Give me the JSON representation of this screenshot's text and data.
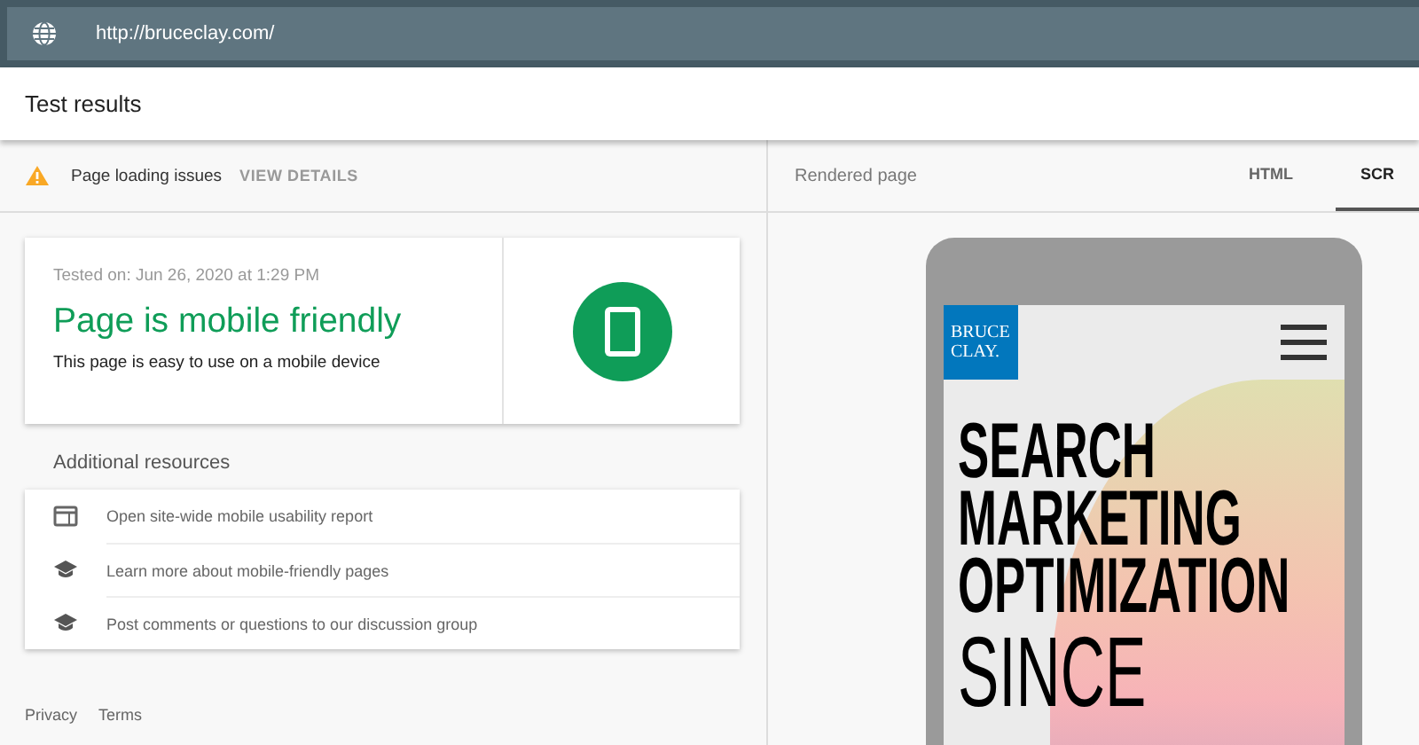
{
  "url_bar": {
    "url": "http://bruceclay.com/"
  },
  "header": {
    "title": "Test results"
  },
  "issues": {
    "label": "Page loading issues",
    "action": "VIEW DETAILS"
  },
  "result": {
    "tested_on": "Tested on: Jun 26, 2020 at 1:29 PM",
    "verdict": "Page is mobile friendly",
    "description": "This page is easy to use on a mobile device"
  },
  "resources": {
    "heading": "Additional resources",
    "items": [
      {
        "kind": "report",
        "label": "Open site-wide mobile usability report"
      },
      {
        "kind": "learn",
        "label": "Learn more about mobile-friendly pages"
      },
      {
        "kind": "learn",
        "label": "Post comments or questions to our discussion group"
      }
    ]
  },
  "footer": {
    "links": [
      "Privacy",
      "Terms"
    ]
  },
  "rendered": {
    "title": "Rendered page",
    "tabs": [
      {
        "label": "HTML",
        "selected": false
      },
      {
        "label": "SCR",
        "selected": true
      }
    ],
    "preview": {
      "logo_lines": [
        "BRUCE",
        "CLAY."
      ],
      "headline": [
        "SEARCH",
        "MARKETING",
        "OPTIMIZATION"
      ],
      "subline": "SINCE"
    }
  }
}
